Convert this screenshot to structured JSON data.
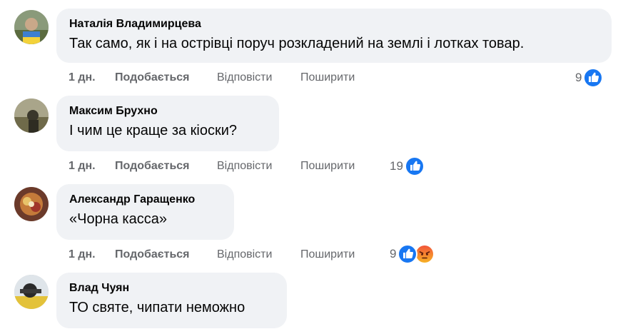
{
  "labels": {
    "like": "Подобається",
    "reply": "Відповісти",
    "share": "Поширити"
  },
  "colors": {
    "bubble": "#f0f2f5",
    "meta_text": "#65676b",
    "like_blue": "#1877f2",
    "angry_orange": "#f2553a"
  },
  "comments": [
    {
      "author": "Наталія Владимирцева",
      "text": "Так само, як і на острівці поруч розкладений на землі і лотках товар.",
      "time": "1 дн.",
      "reaction_count": "9",
      "reactions": [
        "like-icon"
      ]
    },
    {
      "author": "Максим Брухно",
      "text": "І чим це краще за кіоски?",
      "time": "1 дн.",
      "reaction_count": "19",
      "reactions": [
        "like-icon"
      ]
    },
    {
      "author": "Александр Гаращенко",
      "text": "«Чорна касса»",
      "time": "1 дн.",
      "reaction_count": "9",
      "reactions": [
        "like-icon",
        "angry-icon"
      ]
    },
    {
      "author": "Влад Чуян",
      "text": "ТО святе, чипати неможно"
    }
  ]
}
